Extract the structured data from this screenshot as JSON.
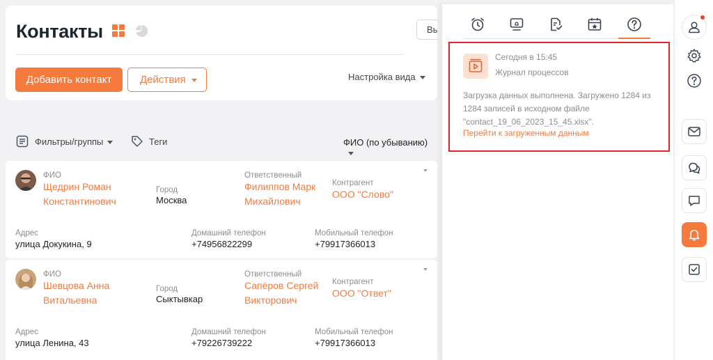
{
  "page": {
    "title": "Контакты",
    "add_button": "Добавить контакт",
    "actions_button": "Действия",
    "view_settings": "Настройка вида",
    "view_button_partial": "Вы"
  },
  "filters": {
    "filters_label": "Фильтры/группы",
    "tags_label": "Теги",
    "sort_label": "ФИО (по убыванию)"
  },
  "labels": {
    "fio": "ФИО",
    "city": "Город",
    "responsible": "Ответственный",
    "counterparty": "Контрагент",
    "address": "Адрес",
    "home_phone": "Домашний телефон",
    "mobile_phone": "Мобильный телефон"
  },
  "contacts": [
    {
      "name_line1": "Щедрин Роман",
      "name_line2": "Константинович",
      "city": "Москва",
      "responsible_line1": "Филиппов Марк",
      "responsible_line2": "Михайлович",
      "counterparty": "ООО \"Слово\"",
      "address": "улица Докукина, 9",
      "home_phone": "+74956822299",
      "mobile_phone": "+79917366013"
    },
    {
      "name_line1": "Шевцова Анна",
      "name_line2": "Витальевна",
      "city": "Сыктывкар",
      "responsible_line1": "Сапёров Сергей",
      "responsible_line2": "Викторович",
      "counterparty": "ООО \"Ответ\"",
      "address": "улица Ленина, 43",
      "home_phone": "+79226739222",
      "mobile_phone": "+79917366013"
    }
  ],
  "notification": {
    "time": "Сегодня в 15:45",
    "title": "Журнал процессов",
    "text": "Загрузка данных выполнена. Загружено 1284 из 1284 записей в исходном файле \"contact_19_06_2023_15_45.xlsx\".",
    "link": "Перейти к загруженным данным"
  },
  "colors": {
    "accent": "#f57a3d",
    "highlight_border": "#e0252b",
    "badge_dot": "#f0402a"
  },
  "icons": {
    "panel_tabs": [
      "alarm-clock-icon",
      "monitor-bell-icon",
      "document-check-icon",
      "calendar-star-icon",
      "help-circle-icon"
    ],
    "rail": [
      "user-icon",
      "gear-icon",
      "help-icon",
      "mail-icon",
      "chats-icon",
      "message-icon",
      "bell-icon",
      "checkbox-icon"
    ]
  }
}
